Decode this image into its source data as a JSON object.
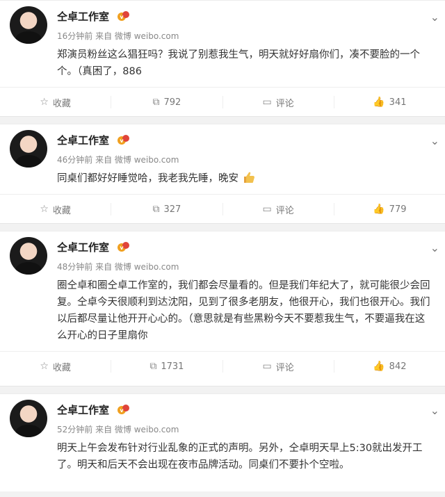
{
  "posts": [
    {
      "name": "仝卓工作室",
      "meta": "16分钟前 来自 微博 weibo.com",
      "text": "郑演员粉丝这么猖狂吗？我说了别惹我生气，明天就好好扇你们，凑不要脸的一个个。（真困了，886",
      "actions": {
        "favorite": "收藏",
        "repost": "792",
        "comment": "评论",
        "like": "341"
      }
    },
    {
      "name": "仝卓工作室",
      "meta": "46分钟前 来自 微博 weibo.com",
      "text": "同桌们都好好睡觉哈，我老我先睡，晚安",
      "actions": {
        "favorite": "收藏",
        "repost": "327",
        "comment": "评论",
        "like": "779"
      }
    },
    {
      "name": "仝卓工作室",
      "meta": "48分钟前 来自 微博 weibo.com",
      "text": "圈仝卓和圈仝卓工作室的，我们都会尽量看的。但是我们年纪大了，就可能很少会回复。仝卓今天很顺利到达沈阳，见到了很多老朋友，他很开心，我们也很开心。我们以后都尽量让他开开心心的。（意思就是有些黑粉今天不要惹我生气，不要逼我在这么开心的日子里扇你",
      "actions": {
        "favorite": "收藏",
        "repost": "1731",
        "comment": "评论",
        "like": "842"
      }
    },
    {
      "name": "仝卓工作室",
      "meta": "52分钟前 来自 微博 weibo.com",
      "text": "明天上午会发布针对行业乱象的正式的声明。另外，仝卓明天早上5:30就出发开工了。明天和后天不会出现在夜市品牌活动。同桌们不要扑个空啦。",
      "actions": null
    }
  ],
  "icons": {
    "favorite": "star-icon",
    "repost": "repost-icon",
    "comment": "comment-icon",
    "like": "thumbs-up-icon",
    "verify": "verified-badge-icon",
    "menu": "chevron-down-icon"
  }
}
